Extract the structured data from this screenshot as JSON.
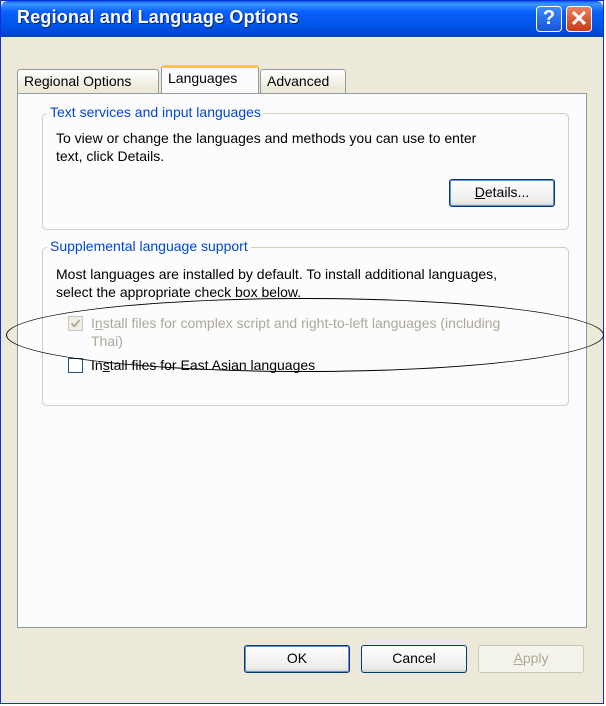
{
  "window": {
    "title": "Regional and Language Options",
    "help_glyph": "?",
    "close_glyph": "✕"
  },
  "tabs": [
    {
      "label": "Regional Options",
      "active": false
    },
    {
      "label": "Languages",
      "active": true
    },
    {
      "label": "Advanced",
      "active": false
    }
  ],
  "text_services": {
    "legend": "Text services and input languages",
    "description_line1": "To view or change the languages and methods you can use to enter",
    "description_line2": "text, click Details.",
    "details_button": {
      "pre": "",
      "accel": "D",
      "post": "etails..."
    }
  },
  "supplemental": {
    "legend": "Supplemental language support",
    "description_line1": "Most languages are installed by default. To install additional languages,",
    "description_line2": "select the appropriate check box below.",
    "complex_script": {
      "label_pre": "I",
      "label_accel": "n",
      "label_post": "stall files for complex script and right-to-left languages (including",
      "label_line2": "Thai)",
      "checked": true,
      "enabled": false
    },
    "east_asian": {
      "label_pre": "In",
      "label_accel": "s",
      "label_post": "tall files for East Asian languages",
      "checked": false,
      "enabled": true
    }
  },
  "buttons": {
    "ok": "OK",
    "cancel": "Cancel",
    "apply": {
      "accel": "A",
      "post": "pply"
    }
  },
  "colors": {
    "title_bar": "#0053e6",
    "legend_text": "#0046d5",
    "active_tab_highlight": "#ffc73c",
    "dialog_face": "#ece9d8"
  }
}
